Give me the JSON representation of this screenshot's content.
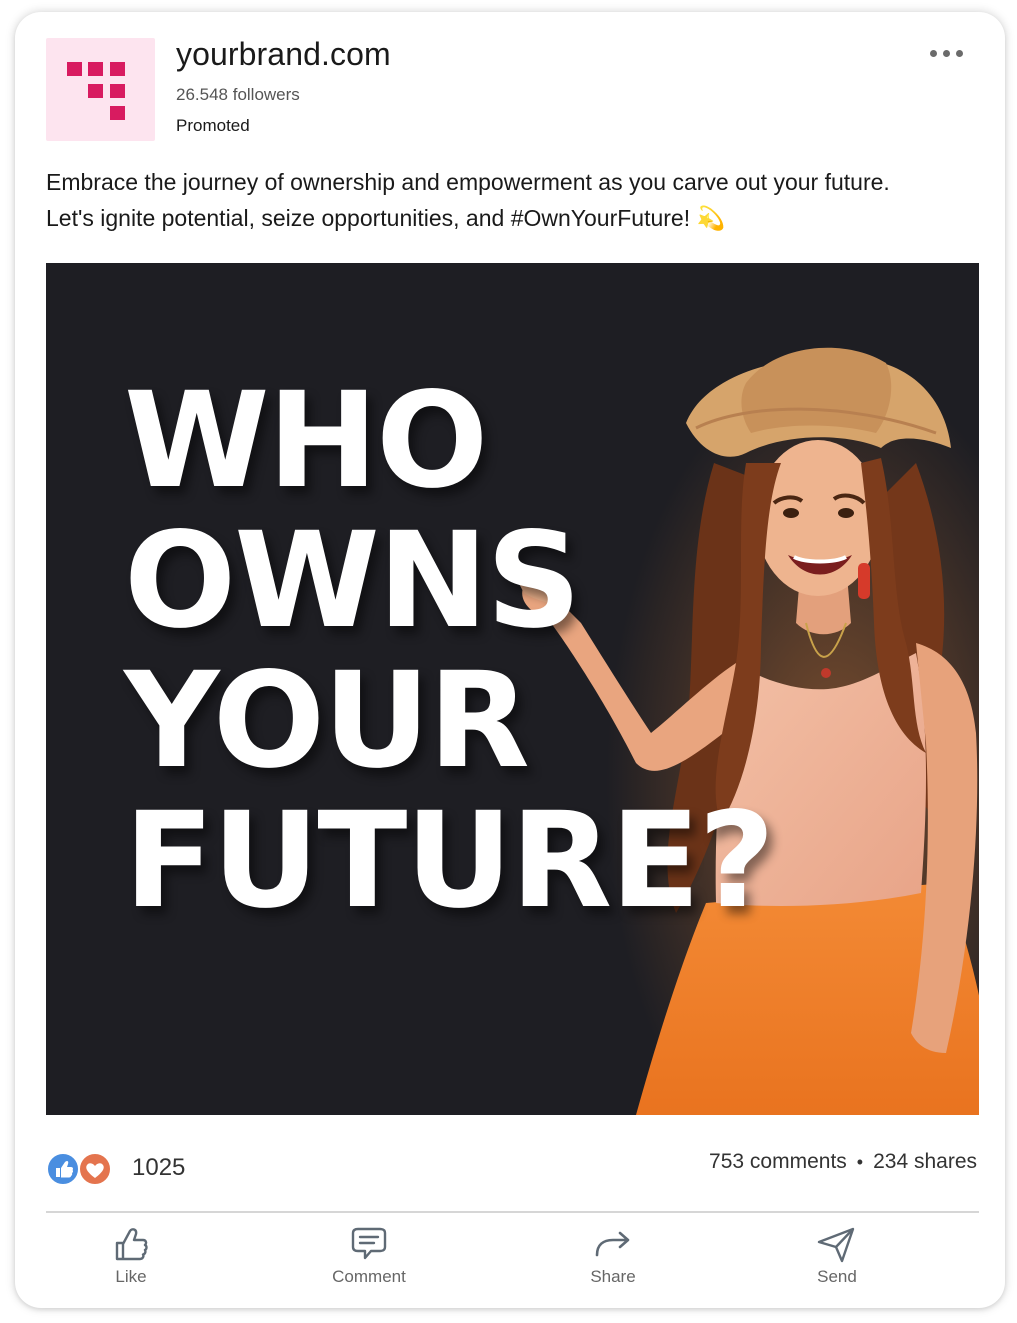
{
  "post": {
    "brand_name": "yourbrand.com",
    "followers": "26.548 followers",
    "status": "Promoted",
    "caption": "Embrace the journey of ownership and empowerment as you carve out your future. Let's ignite potential, seize opportunities, and #OwnYourFuture! 💫",
    "image": {
      "headline_lines": [
        "WHO",
        "OWNS",
        "YOUR",
        "FUTURE?"
      ],
      "background_color": "#1e1e23"
    }
  },
  "engagement": {
    "reactions_count": "1025",
    "comments": "753 comments",
    "separator": "•",
    "shares": "234 shares",
    "reaction_icons": [
      "thumbs-up-icon",
      "heart-icon"
    ]
  },
  "actions": {
    "like": "Like",
    "comment": "Comment",
    "share": "Share",
    "send": "Send"
  },
  "colors": {
    "brand_accent": "#d81b60",
    "logo_background": "#fde4ef",
    "like_blue": "#4a8ee0",
    "love_orange": "#e4744e"
  }
}
